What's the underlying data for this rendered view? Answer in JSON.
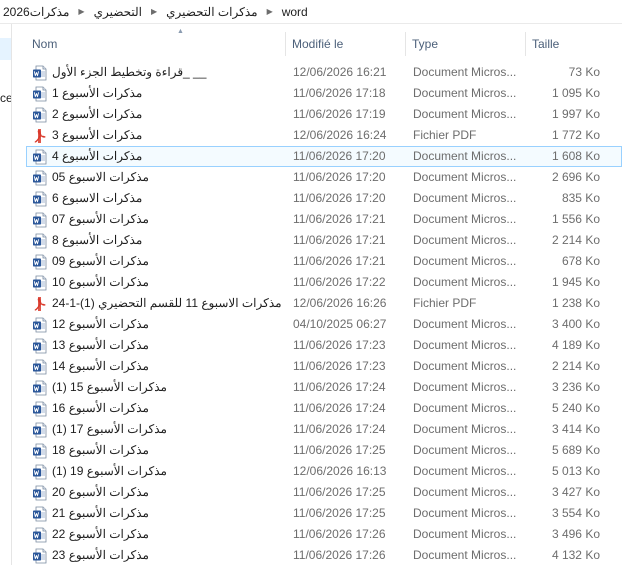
{
  "breadcrumb": [
    "مذكرات2026",
    "التحضيري",
    "مذكرات التحضيري",
    "word"
  ],
  "left_pane_text": "cer",
  "columns": {
    "name": "Nom",
    "modified": "Modifié le",
    "type": "Type",
    "size": "Taille"
  },
  "colors": {
    "word_blue": "#2b579a",
    "pdf_red": "#d93a2b",
    "selection_border": "#99d1ff",
    "header_text": "#4c607a"
  },
  "files": [
    {
      "name": "__ _قراءة وتخطيط الجزء الأول",
      "modified": "12/06/2026 16:21",
      "type": "Document Micros...",
      "size": "73 Ko",
      "icon": "word-doc-icon",
      "selected": false
    },
    {
      "name": "مذكرات الأسبوع 1",
      "modified": "11/06/2026 17:18",
      "type": "Document Micros...",
      "size": "1 095 Ko",
      "icon": "word-doc-icon",
      "selected": false
    },
    {
      "name": "مذكرات الأسبوع 2",
      "modified": "11/06/2026 17:19",
      "type": "Document Micros...",
      "size": "1 997 Ko",
      "icon": "word-doc-icon",
      "selected": false
    },
    {
      "name": "مذكرات الأسبوع 3",
      "modified": "12/06/2026 16:24",
      "type": "Fichier PDF",
      "size": "1 772 Ko",
      "icon": "pdf-icon",
      "selected": false
    },
    {
      "name": "مذكرات الأسبوع 4",
      "modified": "11/06/2026 17:20",
      "type": "Document Micros...",
      "size": "1 608 Ko",
      "icon": "word-doc-icon",
      "selected": true
    },
    {
      "name": "مذكرات الاسبوع 05",
      "modified": "11/06/2026 17:20",
      "type": "Document Micros...",
      "size": "2 696 Ko",
      "icon": "word-doc-icon",
      "selected": false
    },
    {
      "name": "مذكرات الاسبوع 6",
      "modified": "11/06/2026 17:20",
      "type": "Document Micros...",
      "size": "835 Ko",
      "icon": "word-doc-icon",
      "selected": false
    },
    {
      "name": "مذكرات الأسبوع 07",
      "modified": "11/06/2026 17:21",
      "type": "Document Micros...",
      "size": "1 556 Ko",
      "icon": "word-doc-icon",
      "selected": false
    },
    {
      "name": "مذكرات الأسبوع 8",
      "modified": "11/06/2026 17:21",
      "type": "Document Micros...",
      "size": "2 214 Ko",
      "icon": "word-doc-icon",
      "selected": false
    },
    {
      "name": "مذكرات الأسبوع 09",
      "modified": "11/06/2026 17:21",
      "type": "Document Micros...",
      "size": "678 Ko",
      "icon": "word-doc-icon",
      "selected": false
    },
    {
      "name": "مذكرات الأسبوع 10",
      "modified": "11/06/2026 17:22",
      "type": "Document Micros...",
      "size": "1 945 Ko",
      "icon": "word-doc-icon",
      "selected": false
    },
    {
      "name": "مذكرات الاسبوع 11 للقسم التحضيري (1)-1-24",
      "modified": "12/06/2026 16:26",
      "type": "Fichier PDF",
      "size": "1 238 Ko",
      "icon": "pdf-icon",
      "selected": false
    },
    {
      "name": "مذكرات الأسبوع 12",
      "modified": "04/10/2025 06:27",
      "type": "Document Micros...",
      "size": "3 400 Ko",
      "icon": "word-doc-icon",
      "selected": false
    },
    {
      "name": "مذكرات الأسبوع 13",
      "modified": "11/06/2026 17:23",
      "type": "Document Micros...",
      "size": "4 189 Ko",
      "icon": "word-doc-icon",
      "selected": false
    },
    {
      "name": "مذكرات الأسبوع 14",
      "modified": "11/06/2026 17:23",
      "type": "Document Micros...",
      "size": "2 214 Ko",
      "icon": "word-doc-icon",
      "selected": false
    },
    {
      "name": "مذكرات الأسبوع 15 (1)",
      "modified": "11/06/2026 17:24",
      "type": "Document Micros...",
      "size": "3 236 Ko",
      "icon": "word-doc-icon",
      "selected": false
    },
    {
      "name": "مذكرات الأسبوع 16",
      "modified": "11/06/2026 17:24",
      "type": "Document Micros...",
      "size": "5 240 Ko",
      "icon": "word-doc-icon",
      "selected": false
    },
    {
      "name": "مذكرات الأسبوع 17 (1)",
      "modified": "11/06/2026 17:24",
      "type": "Document Micros...",
      "size": "3 414 Ko",
      "icon": "word-doc-icon",
      "selected": false
    },
    {
      "name": "مذكرات الأسبوع 18",
      "modified": "11/06/2026 17:25",
      "type": "Document Micros...",
      "size": "5 689 Ko",
      "icon": "word-doc-icon",
      "selected": false
    },
    {
      "name": "مذكرات الأسبوع 19 (1)",
      "modified": "12/06/2026 16:13",
      "type": "Document Micros...",
      "size": "5 013 Ko",
      "icon": "word-doc-icon",
      "selected": false
    },
    {
      "name": "مذكرات الأسبوع 20",
      "modified": "11/06/2026 17:25",
      "type": "Document Micros...",
      "size": "3 427 Ko",
      "icon": "word-doc-icon",
      "selected": false
    },
    {
      "name": "مذكرات الأسبوع 21",
      "modified": "11/06/2026 17:25",
      "type": "Document Micros...",
      "size": "3 554 Ko",
      "icon": "word-doc-icon",
      "selected": false
    },
    {
      "name": "مذكرات الأسبوع 22",
      "modified": "11/06/2026 17:26",
      "type": "Document Micros...",
      "size": "3 496 Ko",
      "icon": "word-doc-icon",
      "selected": false
    },
    {
      "name": "مذكرات الأسبوع 23",
      "modified": "11/06/2026 17:26",
      "type": "Document Micros...",
      "size": "4 132 Ko",
      "icon": "word-doc-icon",
      "selected": false
    }
  ]
}
